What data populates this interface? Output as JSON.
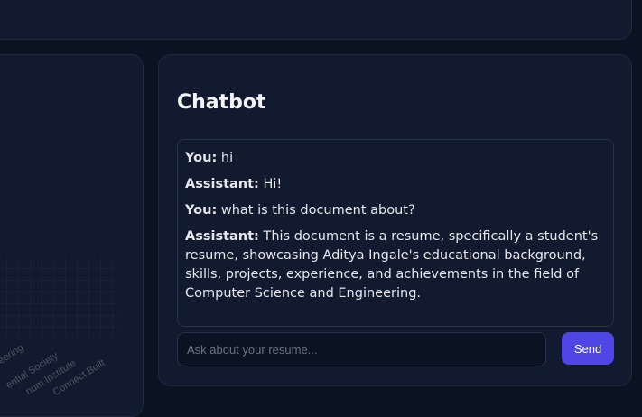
{
  "left_panel": {
    "rotated_labels": [
      "neering",
      "ential Society",
      "num Institute",
      "Connect Built"
    ]
  },
  "chatbot": {
    "title": "Chatbot",
    "messages": [
      {
        "speaker": "You:",
        "text": " hi"
      },
      {
        "speaker": "Assistant:",
        "text": " Hi!"
      },
      {
        "speaker": "You:",
        "text": " what is this document about?"
      },
      {
        "speaker": "Assistant:",
        "text": " This document is a resume, specifically a student's resume, showcasing Aditya Ingale's educational background, skills, projects, experience, and achievements in the field of Computer Science and Engineering."
      }
    ],
    "input": {
      "placeholder": "Ask about your resume...",
      "value": ""
    },
    "send_label": "Send"
  },
  "colors": {
    "accent": "#4f46e5",
    "background": "#0b1222",
    "panel": "#111a2e"
  }
}
